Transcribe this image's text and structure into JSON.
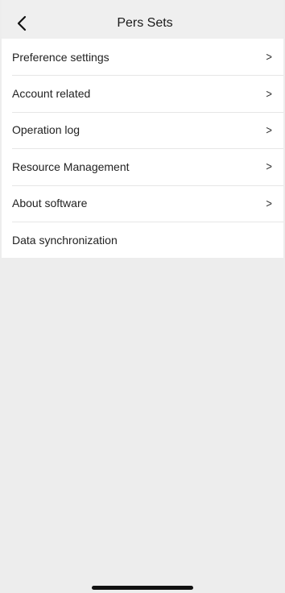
{
  "header": {
    "title": "Pers Sets",
    "back_icon": "chevron-left-icon"
  },
  "menu": {
    "items": [
      {
        "label": "Preference settings",
        "chevron": ">"
      },
      {
        "label": "Account related",
        "chevron": ">"
      },
      {
        "label": "Operation log",
        "chevron": ">"
      },
      {
        "label": "Resource Management",
        "chevron": ">"
      },
      {
        "label": "About software",
        "chevron": ">"
      },
      {
        "label": "Data synchronization",
        "chevron": ""
      }
    ]
  },
  "colors": {
    "background": "#ededed",
    "list_background": "#ffffff",
    "divider": "#e6e6e6",
    "text": "#222222"
  }
}
